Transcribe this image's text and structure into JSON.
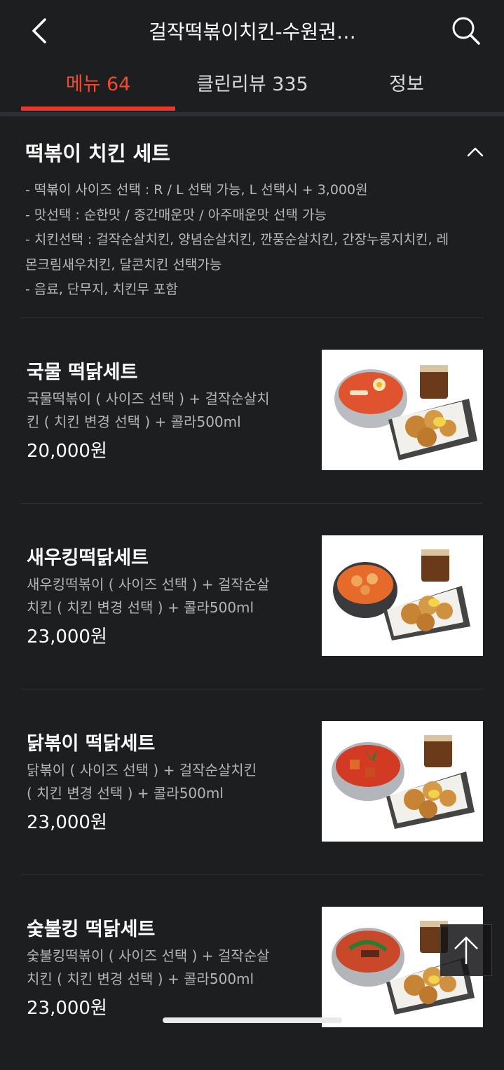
{
  "header": {
    "title": "걸작떡볶이치킨-수원권…"
  },
  "tabs": [
    {
      "label": "메뉴 64",
      "active": true
    },
    {
      "label": "클린리뷰 335",
      "active": false
    },
    {
      "label": "정보",
      "active": false
    }
  ],
  "section": {
    "title": "떡볶이 치킨 세트",
    "description_lines": [
      "- 떡볶이 사이즈 선택 : R / L 선택 가능, L 선택시 + 3,000원",
      "- 맛선택 : 순한맛  /  중간매운맛  /  아주매운맛 선택 가능",
      "- 치킨선택 : 걸작순살치킨, 양념순살치킨, 깐풍순살치킨, 간장누룽지치킨, 레",
      "몬크림새우치킨, 달콘치킨 선택가능",
      "- 음료, 단무지, 치킨무 포함"
    ]
  },
  "menu_items": [
    {
      "name": "국물 떡닭세트",
      "desc_line1": "국물떡볶이 ( 사이즈 선택 ) + 걸작순살치",
      "desc_line2": "킨 ( 치킨 변경 선택 ) + 콜라500ml",
      "price": "20,000원"
    },
    {
      "name": "새우킹떡닭세트",
      "desc_line1": "새우킹떡볶이 ( 사이즈 선택 ) + 걸작순살",
      "desc_line2": "치킨 ( 치킨 변경 선택 ) + 콜라500ml",
      "price": "23,000원"
    },
    {
      "name": "닭볶이 떡닭세트",
      "desc_line1": "닭볶이 ( 사이즈 선택 ) + 걸작순살치킨",
      "desc_line2": " ( 치킨 변경 선택 ) + 콜라500ml",
      "price": "23,000원"
    },
    {
      "name": "숯불킹 떡닭세트",
      "desc_line1": "숯불킹떡볶이 ( 사이즈 선택 ) + 걸작순살",
      "desc_line2": "치킨 ( 치킨 변경 선택 ) + 콜라500ml",
      "price": "23,000원"
    }
  ],
  "icons": {
    "back": "chevron-left-icon",
    "search": "search-icon",
    "collapse": "chevron-up-icon",
    "scroll_top": "arrow-up-icon"
  },
  "colors": {
    "background": "#1c1e20",
    "accent": "#e8382c",
    "active_tab_text": "#f24a2b"
  }
}
